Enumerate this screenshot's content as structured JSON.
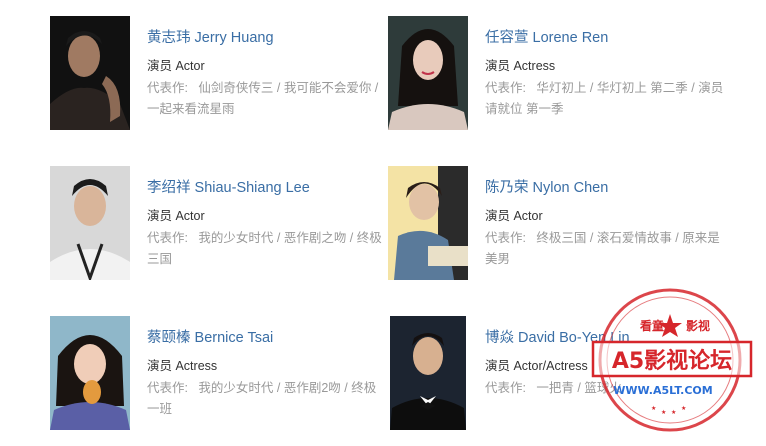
{
  "cast": [
    {
      "name": "黄志玮 Jerry Huang",
      "role": "演员 Actor",
      "works_label": "代表作:",
      "works": "仙剑奇侠传三 / 我可能不会爱你 / 一起来看流星雨"
    },
    {
      "name": "任容萱 Lorene Ren",
      "role": "演员 Actress",
      "works_label": "代表作:",
      "works": "华灯初上 / 华灯初上 第二季 / 演员请就位 第一季"
    },
    {
      "name": "李绍祥 Shiau-Shiang Lee",
      "role": "演员 Actor",
      "works_label": "代表作:",
      "works": "我的少女时代 / 恶作剧之吻 / 终极三国"
    },
    {
      "name": "陈乃荣 Nylon Chen",
      "role": "演员 Actor",
      "works_label": "代表作:",
      "works": "终极三国 / 滚石爱情故事 / 原来是美男"
    },
    {
      "name": "蔡颐榛 Bernice Tsai",
      "role": "演员 Actress",
      "works_label": "代表作:",
      "works": "我的少女时代 / 恶作剧2吻 / 终极一班"
    },
    {
      "name": "博焱 David Bo-Yen Lin",
      "role": "演员 Actor/Actress",
      "works_label": "代表作:",
      "works": "一把青 / 篮球火"
    }
  ],
  "watermark": {
    "top_left": "看童",
    "top_right": "影视",
    "main": "A5影视论坛",
    "url": "WWW.A5LT.COM",
    "color": "#d6262b"
  },
  "colors": {
    "name_link": "#3a6ea5",
    "role_text": "#333333",
    "works_text": "#999999"
  }
}
